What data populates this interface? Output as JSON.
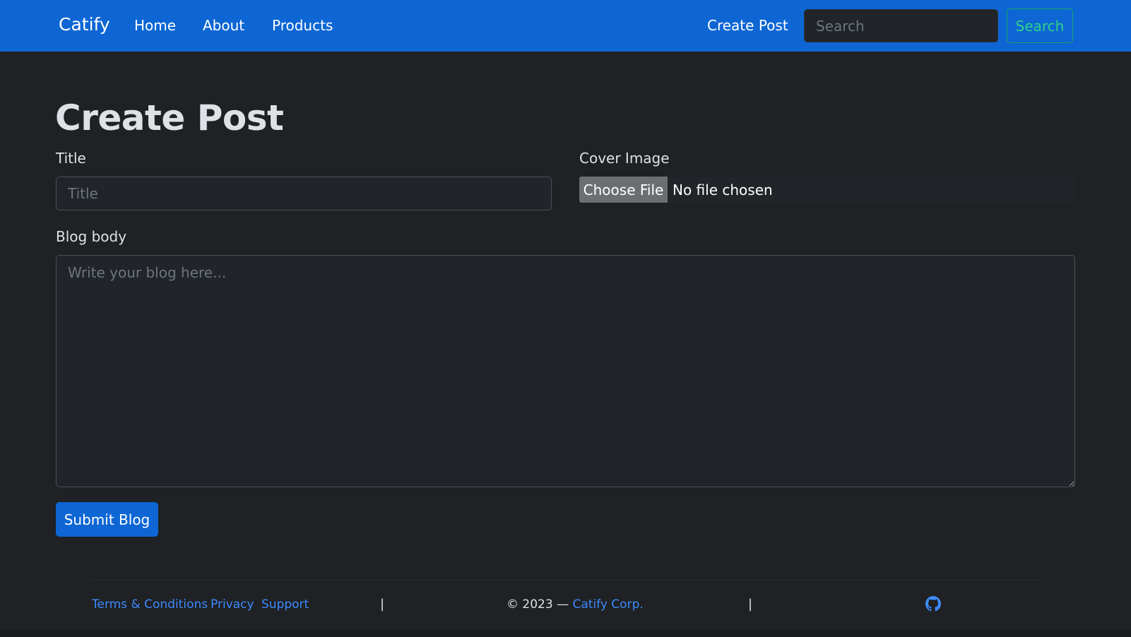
{
  "navbar": {
    "brand": "Catify",
    "links": [
      "Home",
      "About",
      "Products"
    ],
    "create_post": "Create Post",
    "search_placeholder": "Search",
    "search_button": "Search"
  },
  "main": {
    "title": "Create Post",
    "title_label": "Title",
    "title_placeholder": "Title",
    "cover_label": "Cover Image",
    "file_button": "Choose File",
    "file_status": "No file chosen",
    "body_label": "Blog body",
    "body_placeholder": "Write your blog here...",
    "submit_button": "Submit Blog"
  },
  "footer": {
    "links": [
      "Terms & Conditions",
      "Privacy",
      "Support"
    ],
    "separator": "|",
    "copyright_prefix": "© 2023 — ",
    "copyright_link": "Catify Corp.",
    "github_icon": "github-icon"
  },
  "colors": {
    "navbar": "#0d66d4",
    "background": "#1f2124",
    "link": "#3d8bfd",
    "search_button": "#2fd186"
  }
}
